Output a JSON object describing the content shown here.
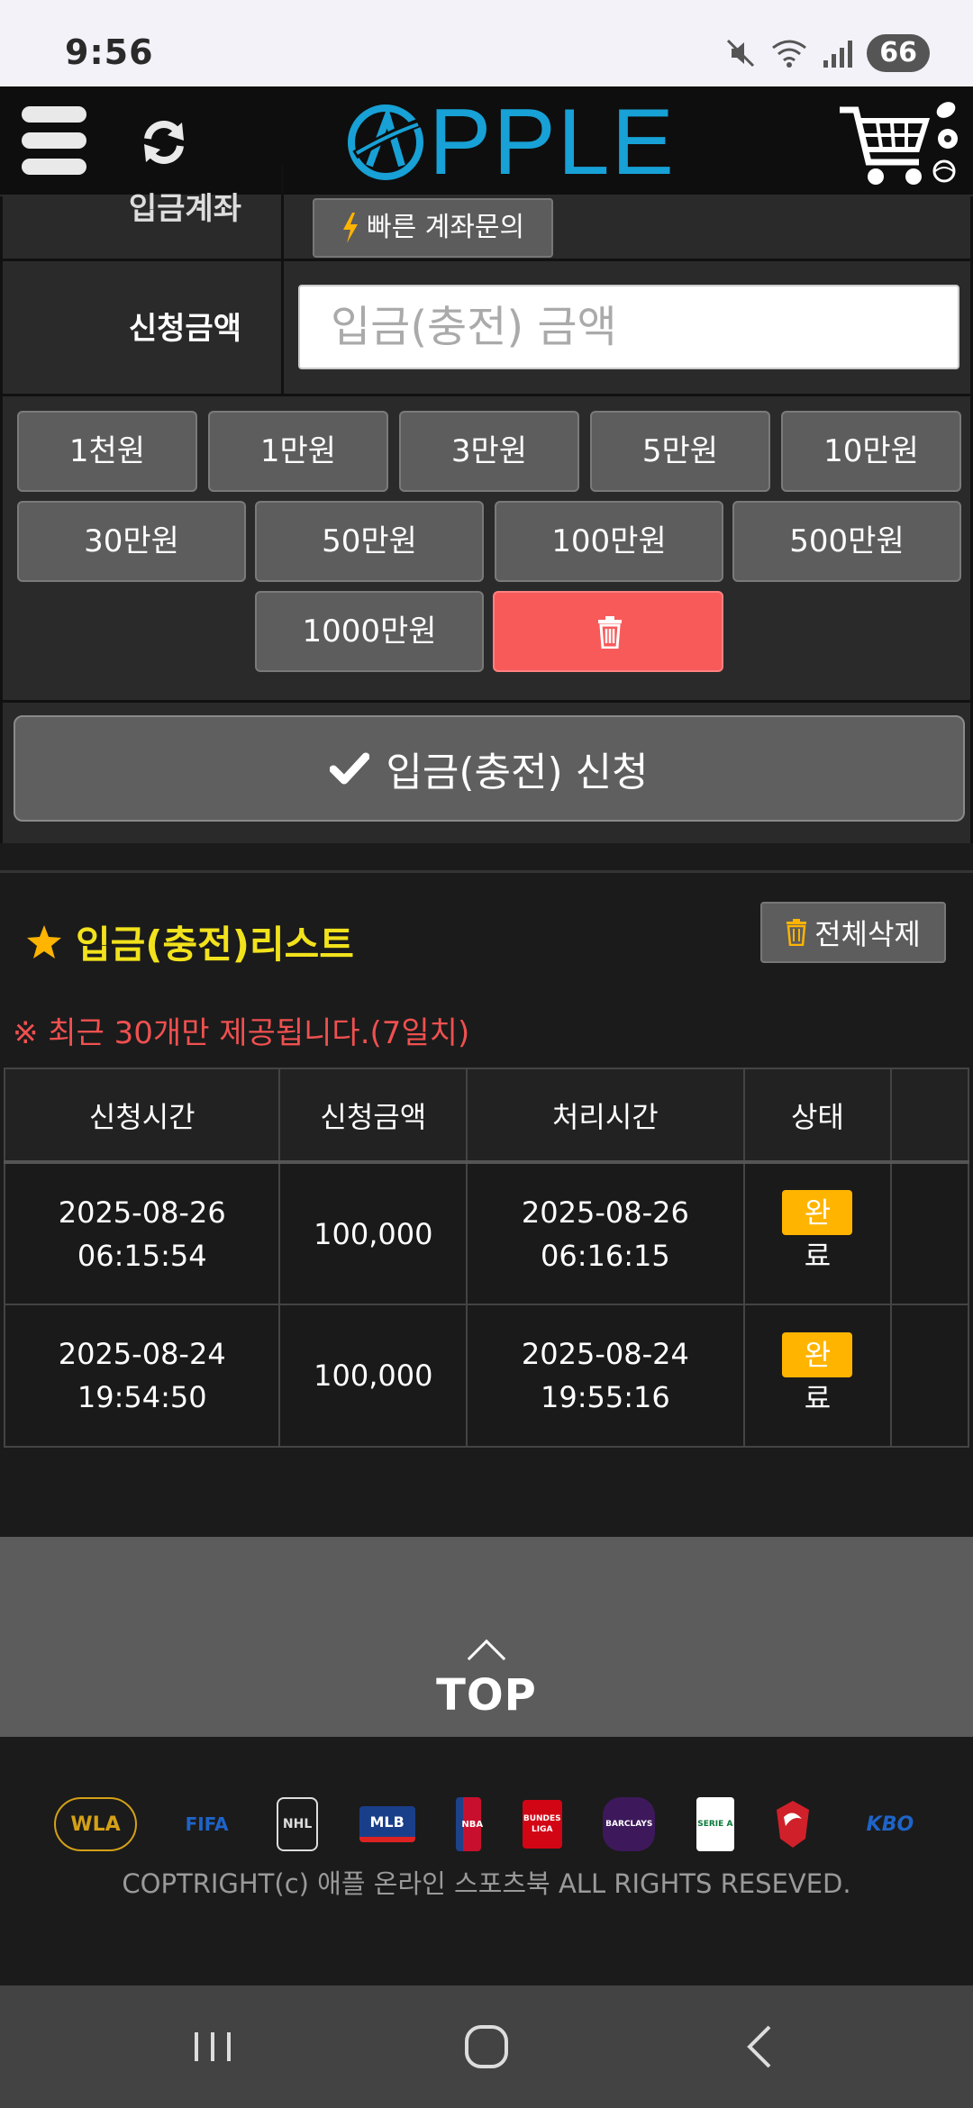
{
  "status_bar": {
    "time": "9:56",
    "battery": "66"
  },
  "header": {
    "logo_text": "PPLE"
  },
  "form": {
    "account_label": "입금계좌",
    "quick_inquiry": "빠른 계좌문의",
    "amount_label": "신청금액",
    "amount_placeholder": "입금(충전) 금액",
    "amount_buttons": [
      "1천원",
      "1만원",
      "3만원",
      "5만원",
      "10만원",
      "30만원",
      "50만원",
      "100만원",
      "500만원",
      "1000만원"
    ],
    "submit_label": "입금(충전) 신청"
  },
  "list": {
    "title": "입금(충전)리스트",
    "delete_all": "전체삭제",
    "notice": "※ 최근 30개만 제공됩니다.(7일치)",
    "columns": [
      "신청시간",
      "신청금액",
      "처리시간",
      "상태",
      ""
    ],
    "rows": [
      {
        "req_date": "2025-08-26",
        "req_time": "06:15:54",
        "amount": "100,000",
        "proc_date": "2025-08-26",
        "proc_time": "06:16:15",
        "status_1": "완",
        "status_2": "료"
      },
      {
        "req_date": "2025-08-24",
        "req_time": "19:54:50",
        "amount": "100,000",
        "proc_date": "2025-08-24",
        "proc_time": "19:55:16",
        "status_1": "완",
        "status_2": "료"
      }
    ]
  },
  "top_button": "TOP",
  "footer": {
    "logos": [
      "WLA",
      "FIFA",
      "NHL",
      "MLB",
      "NBA",
      "BUNDES LIGA",
      "BARCLAYS",
      "SERIE A",
      "KBO"
    ],
    "copyright": "COPTRIGHT(c) 애플 온라인 스포츠북 ALL RIGHTS RESEVED."
  },
  "colors": {
    "accent_blue": "#17a1d6",
    "title_yellow": "#f2e21c",
    "badge": "#ffb400",
    "danger": "#f85a5a"
  }
}
